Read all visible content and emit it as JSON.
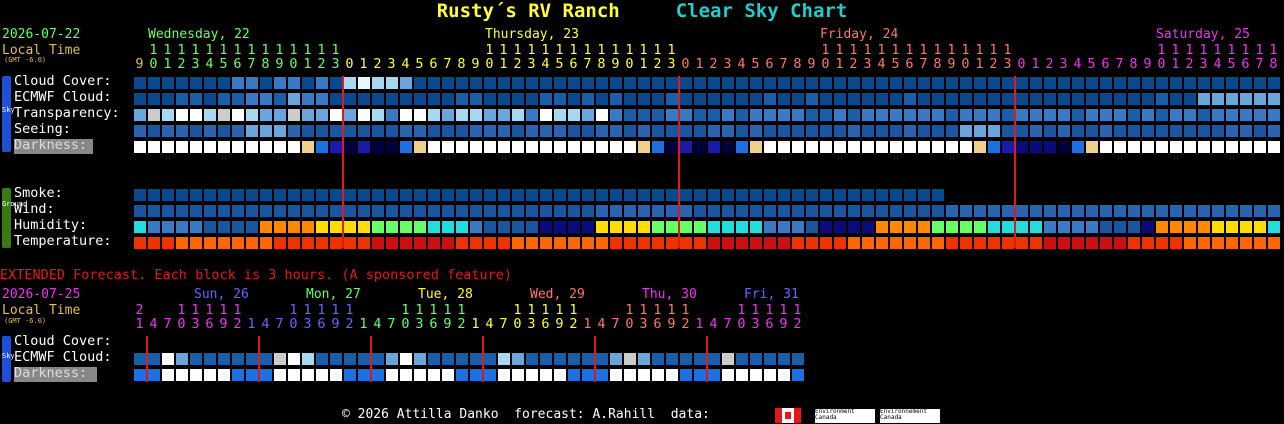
{
  "title": {
    "site": "Rusty´s RV Ranch",
    "chart": "Clear Sky Chart"
  },
  "main": {
    "date": "2026-07-22",
    "local_time": "Local Time",
    "gmt": "(GMT -6.0)",
    "days": [
      {
        "label": "Wednesday, 22",
        "color": "#66ff66"
      },
      {
        "label": "Thursday, 23",
        "color": "#ffff33"
      },
      {
        "label": "Friday, 24",
        "color": "#ff7766"
      },
      {
        "label": "Saturday, 25",
        "color": "#ee33ee"
      }
    ],
    "sky_labels": [
      "Cloud Cover:",
      "ECMWF Cloud:",
      "Transparency:",
      "Seeing:",
      "Darkness:"
    ],
    "ground_labels": [
      "Smoke:",
      "Wind:",
      "Humidity:",
      "Temperature:"
    ],
    "sky_side": "Sky",
    "ground_side": "Ground"
  },
  "extended": {
    "banner": "EXTENDED Forecast. Each block is 3 hours. (A sponsored feature)",
    "date": "2026-07-25",
    "local_time": "Local Time",
    "gmt": "(GMT -6.0)",
    "days": [
      {
        "label": "Sun, 26",
        "color": "#6666ff"
      },
      {
        "label": "Mon, 27",
        "color": "#66ff66"
      },
      {
        "label": "Tue, 28",
        "color": "#ffff33"
      },
      {
        "label": "Wed, 29",
        "color": "#ff7766"
      },
      {
        "label": "Thu, 30",
        "color": "#ee33ee"
      },
      {
        "label": "Fri, 31",
        "color": "#6666ff"
      }
    ],
    "labels": [
      "Cloud Cover:",
      "ECMWF Cloud:",
      "Darkness:"
    ],
    "side": "Sky"
  },
  "footer": {
    "credit": "© 2026 Attilla Danko  forecast: A.Rahill  data:",
    "logo_text_1": "Environment Canada",
    "logo_text_2": "Environnement Canada"
  },
  "colors": {
    "midnight_line": "#e01a1a",
    "sky_sidebar": "#1e4fd8",
    "ground_sidebar": "#3a7a10"
  }
}
